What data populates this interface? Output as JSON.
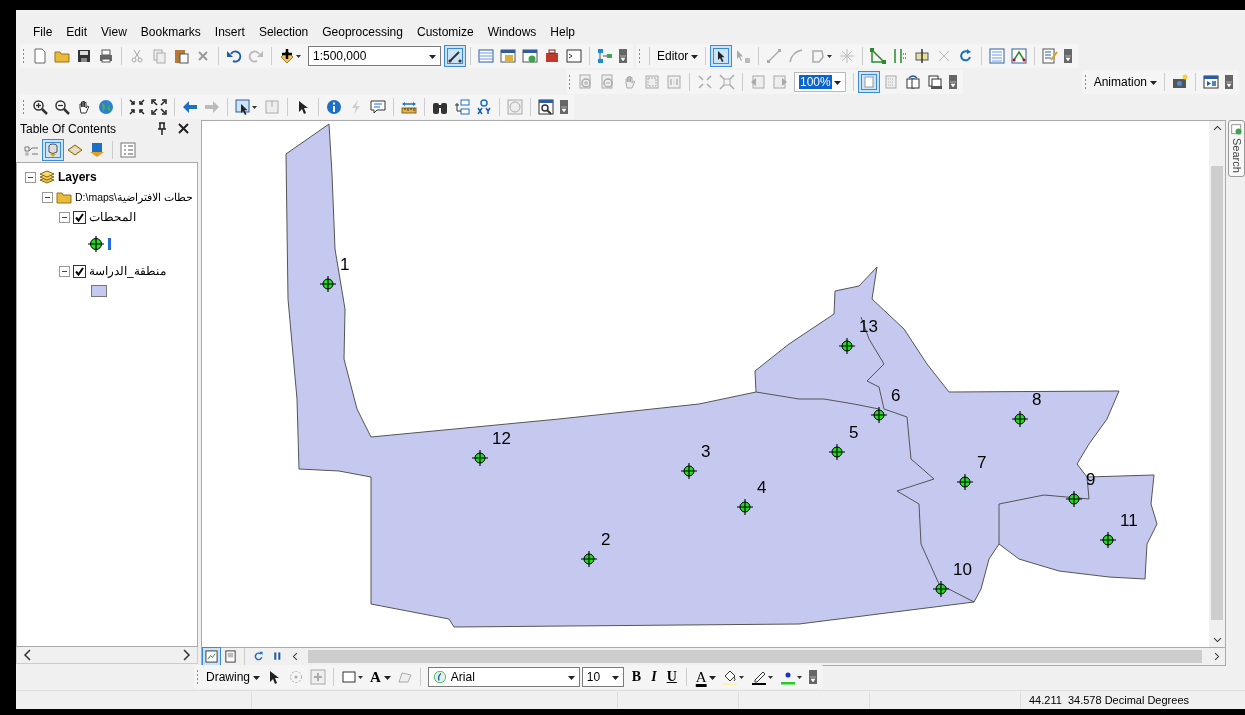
{
  "menu_bar": [
    {
      "label": "File"
    },
    {
      "label": "Edit"
    },
    {
      "label": "View"
    },
    {
      "label": "Bookmarks"
    },
    {
      "label": "Insert"
    },
    {
      "label": "Selection"
    },
    {
      "label": "Geoprocessing"
    },
    {
      "label": "Customize"
    },
    {
      "label": "Windows"
    },
    {
      "label": "Help"
    }
  ],
  "standard_toolbar": {
    "scale": "1:500,000"
  },
  "editor_toolbar": {
    "label": "Editor"
  },
  "layout_toolbar": {
    "zoom": "100%"
  },
  "animation_toolbar": {
    "label": "Animation"
  },
  "table_of_contents": {
    "title": "Table Of Contents",
    "tree": [
      {
        "label": "Layers",
        "expanded": true,
        "children": [
          {
            "label": "D:\\maps\\حطات الافتراضية",
            "expanded": true,
            "children": [
              {
                "label": "المحطات",
                "expanded": true,
                "checked": true,
                "kind": "point"
              },
              {
                "label": "منطقة_الدراسة",
                "expanded": true,
                "checked": true,
                "kind": "polygon"
              }
            ]
          }
        ]
      }
    ]
  },
  "map": {
    "stations": [
      {
        "label": "1"
      },
      {
        "label": "2"
      },
      {
        "label": "3"
      },
      {
        "label": "4"
      },
      {
        "label": "5"
      },
      {
        "label": "6"
      },
      {
        "label": "7"
      },
      {
        "label": "8"
      },
      {
        "label": "9"
      },
      {
        "label": "10"
      },
      {
        "label": "11"
      },
      {
        "label": "12"
      },
      {
        "label": "13"
      }
    ],
    "views": [
      {
        "kind": "data",
        "selected": true
      },
      {
        "kind": "layout",
        "selected": false
      }
    ]
  },
  "search_tab": {
    "label": "Search"
  },
  "drawing_toolbar": {
    "label": "Drawing",
    "text_tool": "A",
    "font": "Arial",
    "font_size": "10",
    "bold": "B",
    "italic": "I",
    "underline": "U",
    "font_color": "A"
  },
  "status_bar": {
    "coordinates": "44.211  34.578 Decimal Degrees"
  }
}
